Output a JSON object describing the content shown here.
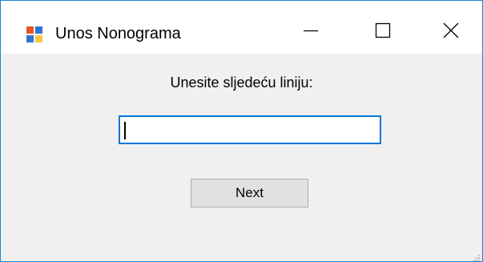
{
  "window": {
    "title": "Unos Nonograma",
    "icon": "app-window-icon",
    "controls": {
      "minimize": "minimize-icon",
      "maximize": "maximize-icon",
      "close": "close-icon"
    }
  },
  "form": {
    "prompt": "Unesite sljedeću liniju:",
    "input_value": "",
    "next_label": "Next"
  },
  "colors": {
    "accent": "#0078d7",
    "window_border": "#1883d7",
    "client_bg": "#f0f0f0",
    "button_bg": "#e1e1e1"
  }
}
